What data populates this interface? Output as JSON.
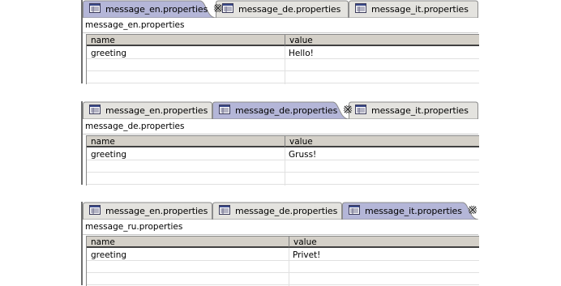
{
  "panels": [
    {
      "tabs": [
        {
          "label": "message_en.properties",
          "active": true
        },
        {
          "label": "message_de.properties",
          "active": false
        },
        {
          "label": "message_it.properties",
          "active": false
        }
      ],
      "file_label": "message_en.properties",
      "columns": {
        "name": "name",
        "value": "value"
      },
      "rows": [
        {
          "name": "greeting",
          "value": "Hello!"
        },
        {
          "name": "",
          "value": ""
        },
        {
          "name": "",
          "value": ""
        }
      ]
    },
    {
      "tabs": [
        {
          "label": "message_en.properties",
          "active": false
        },
        {
          "label": "message_de.properties",
          "active": true
        },
        {
          "label": "message_it.properties",
          "active": false
        }
      ],
      "file_label": "message_de.properties",
      "columns": {
        "name": "name",
        "value": "value"
      },
      "rows": [
        {
          "name": "greeting",
          "value": "Gruss!"
        },
        {
          "name": "",
          "value": ""
        },
        {
          "name": "",
          "value": ""
        }
      ]
    },
    {
      "tabs": [
        {
          "label": "message_en.properties",
          "active": false
        },
        {
          "label": "message_de.properties",
          "active": false
        },
        {
          "label": "message_it.properties",
          "active": true
        }
      ],
      "file_label": "message_ru.properties",
      "columns": {
        "name": "name",
        "value": "value"
      },
      "rows": [
        {
          "name": "greeting",
          "value": "Privet!"
        },
        {
          "name": "",
          "value": ""
        },
        {
          "name": "",
          "value": ""
        }
      ]
    }
  ],
  "icons": {
    "tab_file": "properties-file-icon",
    "tab_close": "close-icon"
  },
  "colors": {
    "active_tab": "#b4b6d8",
    "inactive_tab": "#e4e3df",
    "tab_border": "#8c8c8c",
    "header_bg": "#d4d0c8"
  }
}
